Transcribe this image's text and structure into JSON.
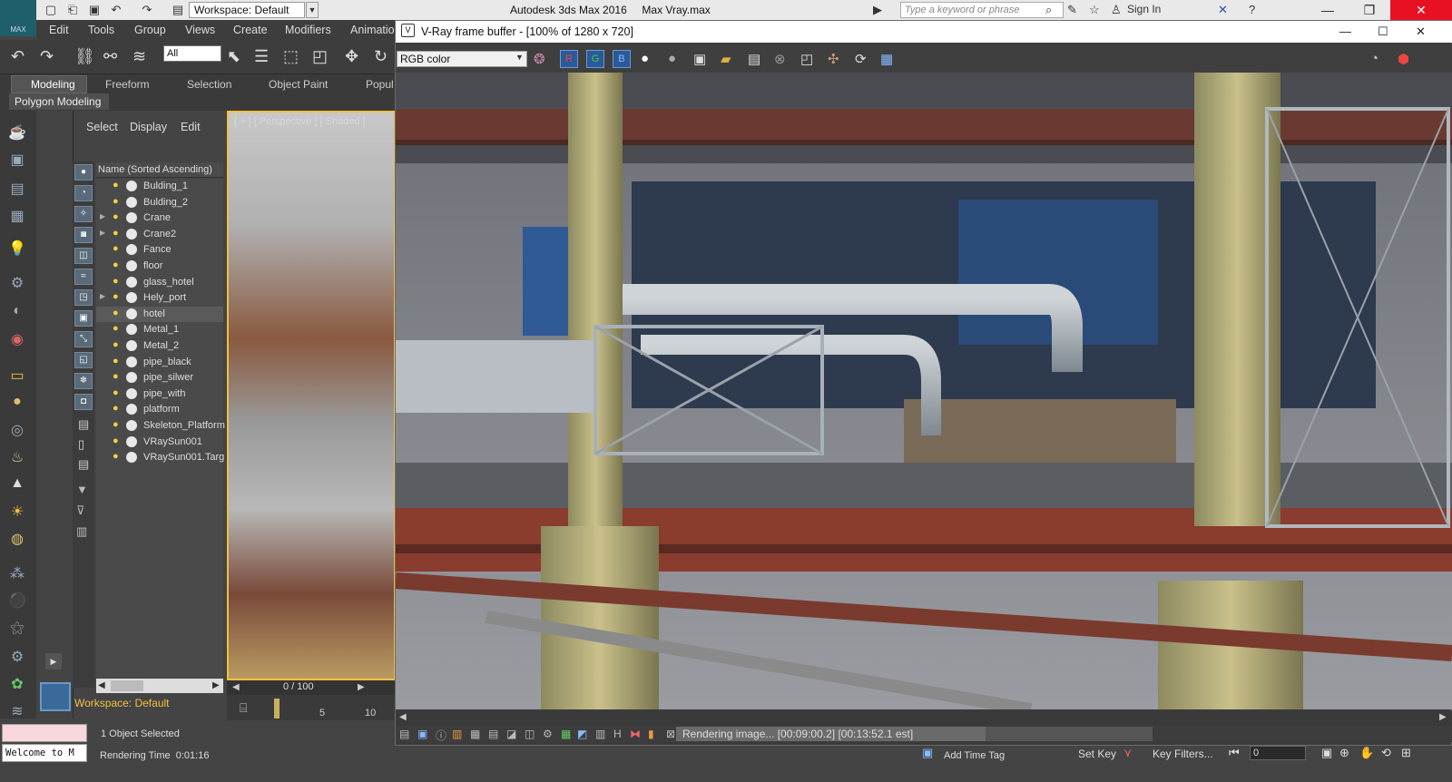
{
  "titlebar": {
    "app_title": "Autodesk 3ds Max 2016     Max Vray.max",
    "logo_text": "MAX",
    "workspace": "Workspace: Default",
    "search_placeholder": "Type a keyword or phrase",
    "sign_in": "Sign In"
  },
  "menu": {
    "items": [
      "Edit",
      "Tools",
      "Group",
      "Views",
      "Create",
      "Modifiers",
      "Animatio"
    ]
  },
  "toolbar": {
    "selection_filter": "All"
  },
  "ribbon": {
    "tabs": [
      "Modeling",
      "Freeform",
      "Selection",
      "Object Paint",
      "Popul"
    ],
    "panel_label": "Polygon Modeling"
  },
  "scene_explorer": {
    "tabs": [
      "Select",
      "Display",
      "Edit"
    ],
    "column_header": "Name (Sorted Ascending)",
    "items": [
      {
        "name": "Bulding_1",
        "expand": false,
        "selected": false
      },
      {
        "name": "Bulding_2",
        "expand": false,
        "selected": false
      },
      {
        "name": "Crane",
        "expand": true,
        "selected": false
      },
      {
        "name": "Crane2",
        "expand": true,
        "selected": false
      },
      {
        "name": "Fance",
        "expand": false,
        "selected": false
      },
      {
        "name": "floor",
        "expand": false,
        "selected": false
      },
      {
        "name": "glass_hotel",
        "expand": false,
        "selected": false
      },
      {
        "name": "Hely_port",
        "expand": true,
        "selected": false
      },
      {
        "name": "hotel",
        "expand": false,
        "selected": true
      },
      {
        "name": "Metal_1",
        "expand": false,
        "selected": false
      },
      {
        "name": "Metal_2",
        "expand": false,
        "selected": false
      },
      {
        "name": "pipe_black",
        "expand": false,
        "selected": false
      },
      {
        "name": "pipe_silwer",
        "expand": false,
        "selected": false
      },
      {
        "name": "pipe_with",
        "expand": false,
        "selected": false
      },
      {
        "name": "platform",
        "expand": false,
        "selected": false
      },
      {
        "name": "Skeleton_Platform",
        "expand": false,
        "selected": false
      },
      {
        "name": "VRaySun001",
        "expand": false,
        "selected": false
      },
      {
        "name": "VRaySun001.Targ",
        "expand": false,
        "selected": false
      }
    ],
    "workspace_label": "Workspace: Default"
  },
  "viewport": {
    "label": "[ + ] [ Perspective ] [ Shaded ]",
    "time_slider": "0 / 100",
    "ticks": [
      "5",
      "10"
    ]
  },
  "vfb": {
    "title": "V-Ray frame buffer - [100% of 1280 x 720]",
    "icon": "V",
    "channel": "RGB color",
    "channels": [
      "R",
      "G",
      "B"
    ],
    "status": "Rendering image... [00:09:00.2] [00:13:52.1 est]",
    "progress": 0.65
  },
  "status": {
    "selected": "1 Object Selected",
    "render_time": "Rendering Time  0:01:16",
    "add_time_tag": "Add Time Tag",
    "set_key": "Set Key",
    "key_filters": "Key Filters...",
    "frame": "0",
    "maxscript": "Welcome to M"
  },
  "colors": {
    "accent_blue": "#2a5a9a",
    "selection_yellow": "#f0c040",
    "close_red": "#e81123"
  }
}
